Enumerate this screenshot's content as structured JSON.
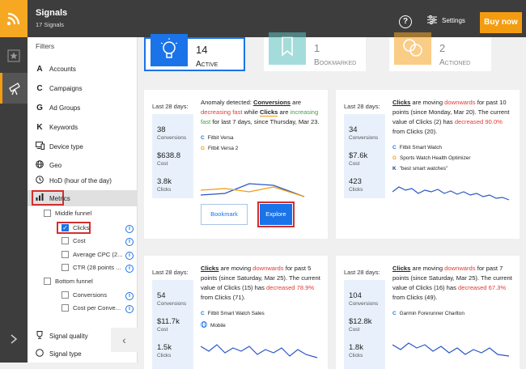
{
  "app": {
    "title": "Signals",
    "subtitle": "17 Signals"
  },
  "topbar": {
    "help_glyph": "?",
    "settings_label": "Settings",
    "buy_label": "Buy now"
  },
  "sidebar": {
    "heading": "Filters",
    "items": [
      {
        "icon": "A",
        "label": "Accounts"
      },
      {
        "icon": "C",
        "label": "Campaigns"
      },
      {
        "icon": "G",
        "label": "Ad Groups"
      },
      {
        "icon": "K",
        "label": "Keywords"
      },
      {
        "icon": "device",
        "label": "Device type"
      },
      {
        "icon": "globe",
        "label": "Geo"
      },
      {
        "icon": "clock",
        "label": "HoD (hour of the day)"
      },
      {
        "icon": "bars",
        "label": "Metrics"
      }
    ],
    "middle_funnel": "Middle funnel",
    "sub_items": [
      {
        "label": "Clicks",
        "checked": true
      },
      {
        "label": "Cost",
        "checked": false
      },
      {
        "label": "Average CPC (2...",
        "checked": false
      },
      {
        "label": "CTR (28 points ...",
        "checked": false
      }
    ],
    "bottom_funnel": "Bottom funnel",
    "bottom_items": [
      {
        "label": "Conversions",
        "checked": false
      },
      {
        "label": "Cost per Conve...",
        "checked": false
      }
    ],
    "signal_quality": "Signal quality",
    "signal_type": "Signal type"
  },
  "stats": [
    {
      "count": "14",
      "label": "Active",
      "color": "#1a73e8"
    },
    {
      "count": "1",
      "label": "Bookmarked",
      "color": "#5bc0be"
    },
    {
      "count": "2",
      "label": "Actioned",
      "color": "#f5a623"
    }
  ],
  "cards": [
    {
      "period": "Last 28 days:",
      "kpis": [
        {
          "value": "38",
          "label": "Conversions"
        },
        {
          "value": "$638.8",
          "label": "Cost"
        },
        {
          "value": "3.8k",
          "label": "Clicks"
        }
      ],
      "anomaly_prefix": "Anomaly detected: ",
      "metric_a": "Conversions",
      "verb_a": " are ",
      "trend_a": "decreasing fast",
      "mid": " while ",
      "metric_b": "Clicks",
      "verb_b": " are ",
      "trend_b": "increasing fast",
      "suffix": " for last 7 days, since Thursday, Mar 23.",
      "sources": [
        {
          "icon": "C",
          "label": "Fitbit Versa"
        },
        {
          "icon": "G",
          "label": "Fitbit Versa 2"
        }
      ],
      "bookmark_label": "Bookmark",
      "explore_label": "Explore"
    },
    {
      "period": "Last 28 days:",
      "kpis": [
        {
          "value": "34",
          "label": "Conversions"
        },
        {
          "value": "$7.6k",
          "label": "Cost"
        },
        {
          "value": "423",
          "label": "Clicks"
        }
      ],
      "metric": "Clicks",
      "text1": " are moving ",
      "trend": "downwards",
      "text2": " for past 10 points (since Monday, Mar 20). The current value of Clicks (2) has ",
      "change": "decreased 90.0%",
      "text3": " from Clicks (20).",
      "sources": [
        {
          "icon": "C",
          "label": "Fitbit Smart Watch"
        },
        {
          "icon": "G",
          "label": "Sports Watch Health Optimizer"
        },
        {
          "icon": "K",
          "label": "\"best smart watches\""
        }
      ]
    },
    {
      "period": "Last 28 days:",
      "kpis": [
        {
          "value": "54",
          "label": "Conversions"
        },
        {
          "value": "$11.7k",
          "label": "Cost"
        },
        {
          "value": "1.5k",
          "label": "Clicks"
        }
      ],
      "metric": "Clicks",
      "text1": " are moving ",
      "trend": "downwards",
      "text2": " for past 5 points (since Saturday, Mar 25). The current value of Clicks (15) has ",
      "change": "decreased 78.9%",
      "text3": " from Clicks (71).",
      "sources": [
        {
          "icon": "C",
          "label": "Fitbit Smart Watch Sales"
        },
        {
          "icon": "globe",
          "label": "Mobile"
        }
      ]
    },
    {
      "period": "Last 28 days:",
      "kpis": [
        {
          "value": "104",
          "label": "Conversions"
        },
        {
          "value": "$12.8k",
          "label": "Cost"
        },
        {
          "value": "1.8k",
          "label": "Clicks"
        }
      ],
      "metric": "Clicks",
      "text1": " are moving ",
      "trend": "downwards",
      "text2": " for past 7 points (since Saturday, Mar 25). The current value of Clicks (16) has ",
      "change": "decreased 67.3%",
      "text3": " from Clicks (49).",
      "sources": [
        {
          "icon": "C",
          "label": "Garmin Forerunner Charlton"
        }
      ]
    }
  ],
  "colors": {
    "accent": "#f39c12",
    "primary": "#1a73e8",
    "red": "#e53935",
    "green": "#43a047",
    "dark": "#3d3d3d"
  }
}
